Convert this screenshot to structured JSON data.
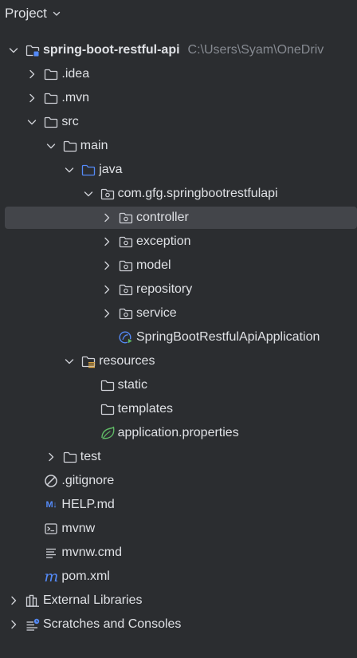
{
  "header": {
    "title": "Project"
  },
  "tree": [
    {
      "label": "spring-boot-restful-api",
      "path": "C:\\Users\\Syam\\OneDriv",
      "bold": true,
      "indent": 0,
      "arrow": "down",
      "icon": "module-folder-icon"
    },
    {
      "label": ".idea",
      "indent": 1,
      "arrow": "right",
      "icon": "folder-icon"
    },
    {
      "label": ".mvn",
      "indent": 1,
      "arrow": "right",
      "icon": "folder-icon"
    },
    {
      "label": "src",
      "indent": 1,
      "arrow": "down",
      "icon": "folder-icon"
    },
    {
      "label": "main",
      "indent": 2,
      "arrow": "down",
      "icon": "folder-icon"
    },
    {
      "label": "java",
      "indent": 3,
      "arrow": "down",
      "icon": "source-folder-icon"
    },
    {
      "label": "com.gfg.springbootrestfulapi",
      "indent": 4,
      "arrow": "down",
      "icon": "package-icon"
    },
    {
      "label": "controller",
      "indent": 5,
      "arrow": "right",
      "icon": "package-icon",
      "selected": true
    },
    {
      "label": "exception",
      "indent": 5,
      "arrow": "right",
      "icon": "package-icon"
    },
    {
      "label": "model",
      "indent": 5,
      "arrow": "right",
      "icon": "package-icon"
    },
    {
      "label": "repository",
      "indent": 5,
      "arrow": "right",
      "icon": "package-icon"
    },
    {
      "label": "service",
      "indent": 5,
      "arrow": "right",
      "icon": "package-icon"
    },
    {
      "label": "SpringBootRestfulApiApplication",
      "indent": 5,
      "arrow": "none",
      "icon": "spring-boot-app-icon"
    },
    {
      "label": "resources",
      "indent": 3,
      "arrow": "down",
      "icon": "resources-folder-icon"
    },
    {
      "label": "static",
      "indent": 4,
      "arrow": "none",
      "icon": "folder-icon"
    },
    {
      "label": "templates",
      "indent": 4,
      "arrow": "none",
      "icon": "folder-icon"
    },
    {
      "label": "application.properties",
      "indent": 4,
      "arrow": "none",
      "icon": "spring-properties-icon"
    },
    {
      "label": "test",
      "indent": 2,
      "arrow": "right",
      "icon": "folder-icon"
    },
    {
      "label": ".gitignore",
      "indent": 1,
      "arrow": "none",
      "icon": "gitignore-icon"
    },
    {
      "label": "HELP.md",
      "indent": 1,
      "arrow": "none",
      "icon": "markdown-icon",
      "icon_text": "M↓"
    },
    {
      "label": "mvnw",
      "indent": 1,
      "arrow": "none",
      "icon": "shell-script-icon"
    },
    {
      "label": "mvnw.cmd",
      "indent": 1,
      "arrow": "none",
      "icon": "text-file-icon"
    },
    {
      "label": "pom.xml",
      "indent": 1,
      "arrow": "none",
      "icon": "maven-icon",
      "icon_text": "m"
    },
    {
      "label": "External Libraries",
      "indent": 0,
      "arrow": "right",
      "icon": "libraries-icon"
    },
    {
      "label": "Scratches and Consoles",
      "indent": 0,
      "arrow": "right",
      "icon": "scratches-icon"
    }
  ],
  "colors": {
    "background": "#2b2d30",
    "text": "#dfe1e5",
    "muted": "#868a91",
    "selection": "#43454a",
    "icon_gray": "#ced0d6",
    "accent_blue": "#548af7",
    "spring_green": "#5fb865",
    "resources_yellow": "#d9a343"
  }
}
